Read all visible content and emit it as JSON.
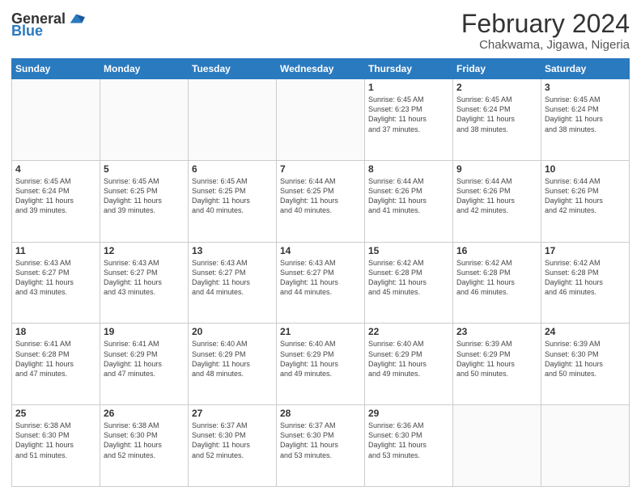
{
  "logo": {
    "text_general": "General",
    "text_blue": "Blue"
  },
  "header": {
    "month_year": "February 2024",
    "location": "Chakwama, Jigawa, Nigeria"
  },
  "days_of_week": [
    "Sunday",
    "Monday",
    "Tuesday",
    "Wednesday",
    "Thursday",
    "Friday",
    "Saturday"
  ],
  "weeks": [
    [
      {
        "day": "",
        "info": ""
      },
      {
        "day": "",
        "info": ""
      },
      {
        "day": "",
        "info": ""
      },
      {
        "day": "",
        "info": ""
      },
      {
        "day": "1",
        "info": "Sunrise: 6:45 AM\nSunset: 6:23 PM\nDaylight: 11 hours\nand 37 minutes."
      },
      {
        "day": "2",
        "info": "Sunrise: 6:45 AM\nSunset: 6:24 PM\nDaylight: 11 hours\nand 38 minutes."
      },
      {
        "day": "3",
        "info": "Sunrise: 6:45 AM\nSunset: 6:24 PM\nDaylight: 11 hours\nand 38 minutes."
      }
    ],
    [
      {
        "day": "4",
        "info": "Sunrise: 6:45 AM\nSunset: 6:24 PM\nDaylight: 11 hours\nand 39 minutes."
      },
      {
        "day": "5",
        "info": "Sunrise: 6:45 AM\nSunset: 6:25 PM\nDaylight: 11 hours\nand 39 minutes."
      },
      {
        "day": "6",
        "info": "Sunrise: 6:45 AM\nSunset: 6:25 PM\nDaylight: 11 hours\nand 40 minutes."
      },
      {
        "day": "7",
        "info": "Sunrise: 6:44 AM\nSunset: 6:25 PM\nDaylight: 11 hours\nand 40 minutes."
      },
      {
        "day": "8",
        "info": "Sunrise: 6:44 AM\nSunset: 6:26 PM\nDaylight: 11 hours\nand 41 minutes."
      },
      {
        "day": "9",
        "info": "Sunrise: 6:44 AM\nSunset: 6:26 PM\nDaylight: 11 hours\nand 42 minutes."
      },
      {
        "day": "10",
        "info": "Sunrise: 6:44 AM\nSunset: 6:26 PM\nDaylight: 11 hours\nand 42 minutes."
      }
    ],
    [
      {
        "day": "11",
        "info": "Sunrise: 6:43 AM\nSunset: 6:27 PM\nDaylight: 11 hours\nand 43 minutes."
      },
      {
        "day": "12",
        "info": "Sunrise: 6:43 AM\nSunset: 6:27 PM\nDaylight: 11 hours\nand 43 minutes."
      },
      {
        "day": "13",
        "info": "Sunrise: 6:43 AM\nSunset: 6:27 PM\nDaylight: 11 hours\nand 44 minutes."
      },
      {
        "day": "14",
        "info": "Sunrise: 6:43 AM\nSunset: 6:27 PM\nDaylight: 11 hours\nand 44 minutes."
      },
      {
        "day": "15",
        "info": "Sunrise: 6:42 AM\nSunset: 6:28 PM\nDaylight: 11 hours\nand 45 minutes."
      },
      {
        "day": "16",
        "info": "Sunrise: 6:42 AM\nSunset: 6:28 PM\nDaylight: 11 hours\nand 46 minutes."
      },
      {
        "day": "17",
        "info": "Sunrise: 6:42 AM\nSunset: 6:28 PM\nDaylight: 11 hours\nand 46 minutes."
      }
    ],
    [
      {
        "day": "18",
        "info": "Sunrise: 6:41 AM\nSunset: 6:28 PM\nDaylight: 11 hours\nand 47 minutes."
      },
      {
        "day": "19",
        "info": "Sunrise: 6:41 AM\nSunset: 6:29 PM\nDaylight: 11 hours\nand 47 minutes."
      },
      {
        "day": "20",
        "info": "Sunrise: 6:40 AM\nSunset: 6:29 PM\nDaylight: 11 hours\nand 48 minutes."
      },
      {
        "day": "21",
        "info": "Sunrise: 6:40 AM\nSunset: 6:29 PM\nDaylight: 11 hours\nand 49 minutes."
      },
      {
        "day": "22",
        "info": "Sunrise: 6:40 AM\nSunset: 6:29 PM\nDaylight: 11 hours\nand 49 minutes."
      },
      {
        "day": "23",
        "info": "Sunrise: 6:39 AM\nSunset: 6:29 PM\nDaylight: 11 hours\nand 50 minutes."
      },
      {
        "day": "24",
        "info": "Sunrise: 6:39 AM\nSunset: 6:30 PM\nDaylight: 11 hours\nand 50 minutes."
      }
    ],
    [
      {
        "day": "25",
        "info": "Sunrise: 6:38 AM\nSunset: 6:30 PM\nDaylight: 11 hours\nand 51 minutes."
      },
      {
        "day": "26",
        "info": "Sunrise: 6:38 AM\nSunset: 6:30 PM\nDaylight: 11 hours\nand 52 minutes."
      },
      {
        "day": "27",
        "info": "Sunrise: 6:37 AM\nSunset: 6:30 PM\nDaylight: 11 hours\nand 52 minutes."
      },
      {
        "day": "28",
        "info": "Sunrise: 6:37 AM\nSunset: 6:30 PM\nDaylight: 11 hours\nand 53 minutes."
      },
      {
        "day": "29",
        "info": "Sunrise: 6:36 AM\nSunset: 6:30 PM\nDaylight: 11 hours\nand 53 minutes."
      },
      {
        "day": "",
        "info": ""
      },
      {
        "day": "",
        "info": ""
      }
    ]
  ]
}
